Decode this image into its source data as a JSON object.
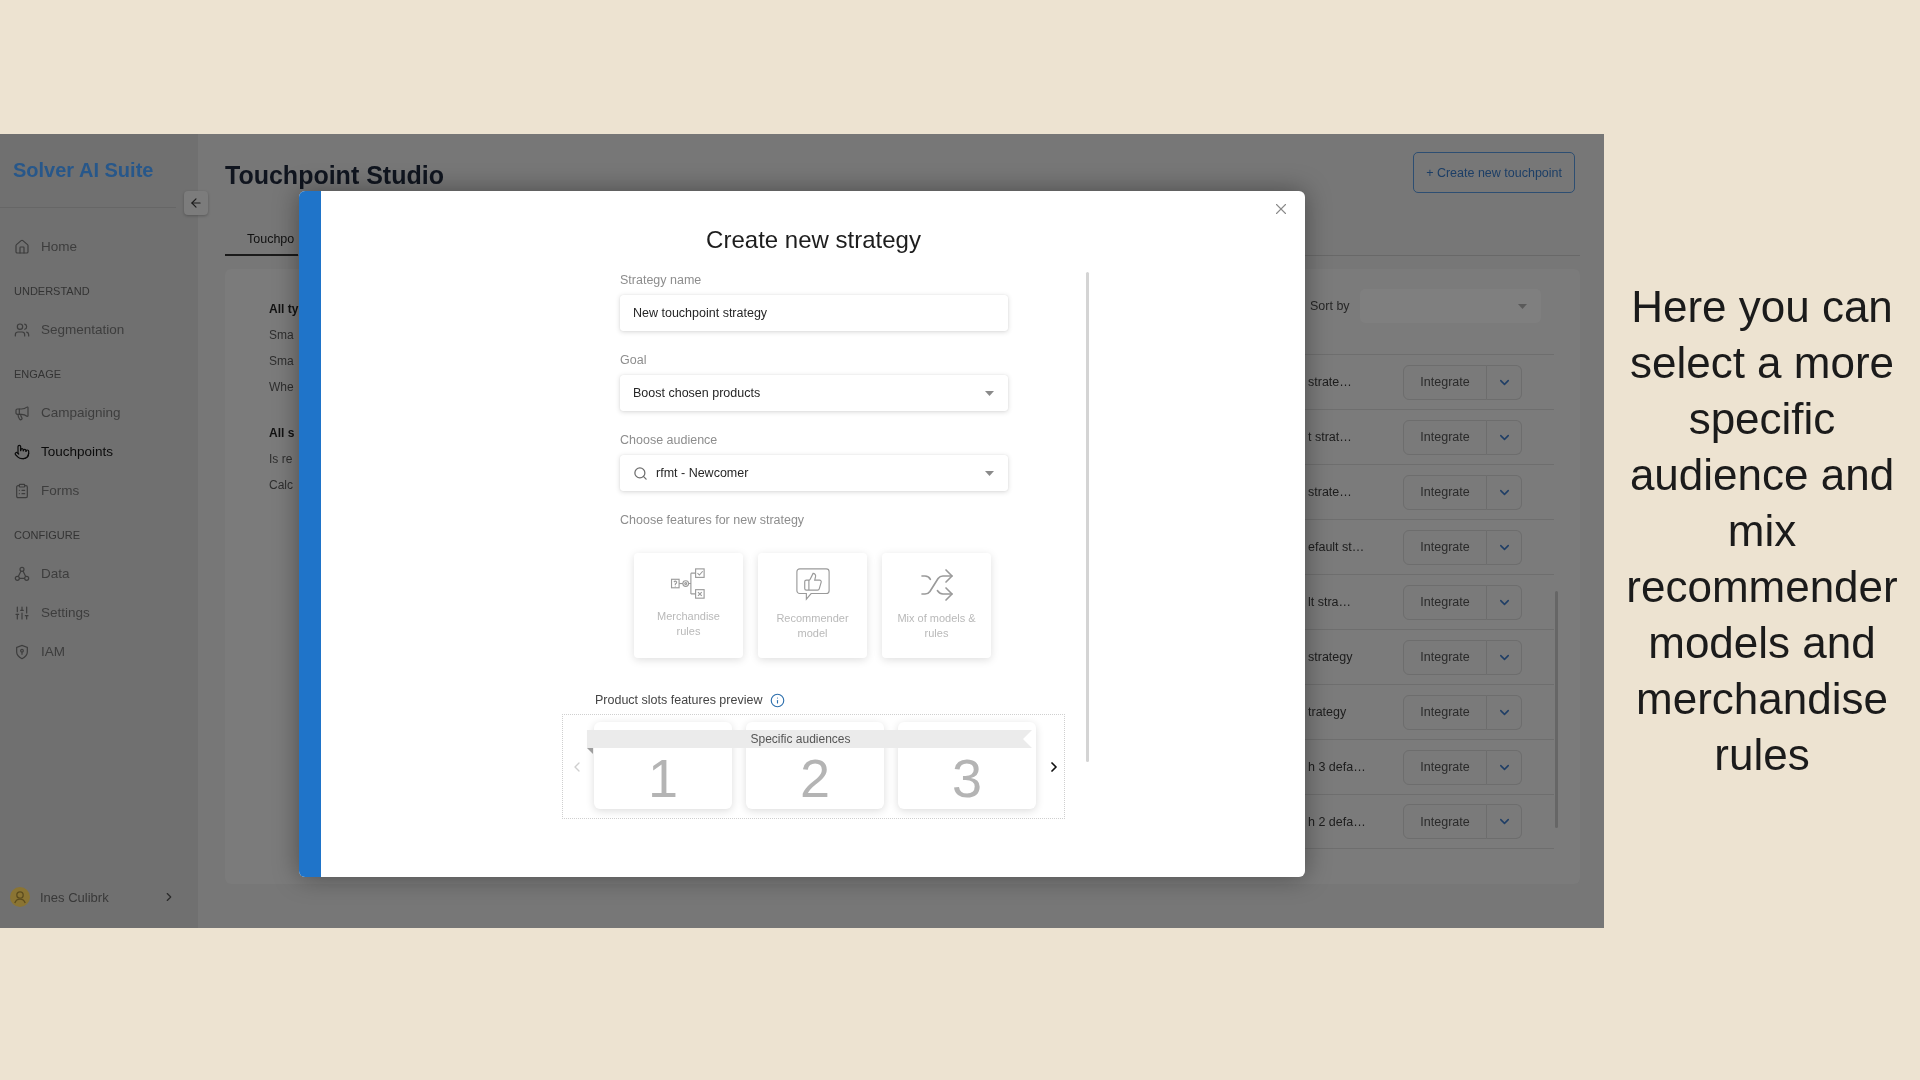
{
  "sidebar": {
    "logo": "Solver AI Suite",
    "sections": [
      {
        "items": [
          {
            "label": "Home",
            "selected": false
          }
        ]
      },
      {
        "heading": "UNDERSTAND",
        "items": [
          {
            "label": "Segmentation",
            "selected": false
          }
        ]
      },
      {
        "heading": "ENGAGE",
        "items": [
          {
            "label": "Campaigning",
            "selected": false
          },
          {
            "label": "Touchpoints",
            "selected": true
          },
          {
            "label": "Forms",
            "selected": false
          }
        ]
      },
      {
        "heading": "CONFIGURE",
        "items": [
          {
            "label": "Data",
            "selected": false
          },
          {
            "label": "Settings",
            "selected": false
          },
          {
            "label": "IAM",
            "selected": false
          }
        ]
      }
    ],
    "user": {
      "name": "Ines Culibrk"
    }
  },
  "header": {
    "title": "Touchpoint Studio",
    "create_button": "+ Create new touchpoint"
  },
  "tabs": [
    {
      "label": "Touchpo",
      "selected": true
    }
  ],
  "filters": [
    {
      "heading": "All ty",
      "options": [
        "Sma",
        "Sma",
        "Whe"
      ]
    },
    {
      "heading": "All s",
      "options": [
        "Is re",
        "Calc"
      ]
    }
  ],
  "sort": {
    "label": "Sort by"
  },
  "strategies": [
    {
      "name": "strate…",
      "action": "Integrate"
    },
    {
      "name": "t strat…",
      "action": "Integrate"
    },
    {
      "name": "strate…",
      "action": "Integrate"
    },
    {
      "name": "efault st…",
      "action": "Integrate"
    },
    {
      "name": "lt stra…",
      "action": "Integrate"
    },
    {
      "name": "strategy",
      "action": "Integrate"
    },
    {
      "name": "trategy",
      "action": "Integrate"
    },
    {
      "name": "h 3 defa…",
      "action": "Integrate"
    },
    {
      "name": "h 2 defa…",
      "action": "Integrate"
    }
  ],
  "modal": {
    "title": "Create new strategy",
    "fields": [
      {
        "kind": "text",
        "label": "Strategy name",
        "value": "New touchpoint strategy"
      },
      {
        "kind": "select",
        "label": "Goal",
        "value": "Boost chosen products"
      },
      {
        "kind": "search_select",
        "label": "Choose audience",
        "value": "rfmt - Newcomer"
      }
    ],
    "features": {
      "label": "Choose features for new strategy",
      "options": [
        "Merchandise rules",
        "Recommender model",
        "Mix of models & rules"
      ]
    },
    "preview": {
      "label": "Product slots features preview",
      "banner": "Specific audiences",
      "slots": [
        "1",
        "2",
        "3"
      ]
    }
  },
  "caption": "Here you can select a more specific audience and mix recommender models and merchandise rules"
}
